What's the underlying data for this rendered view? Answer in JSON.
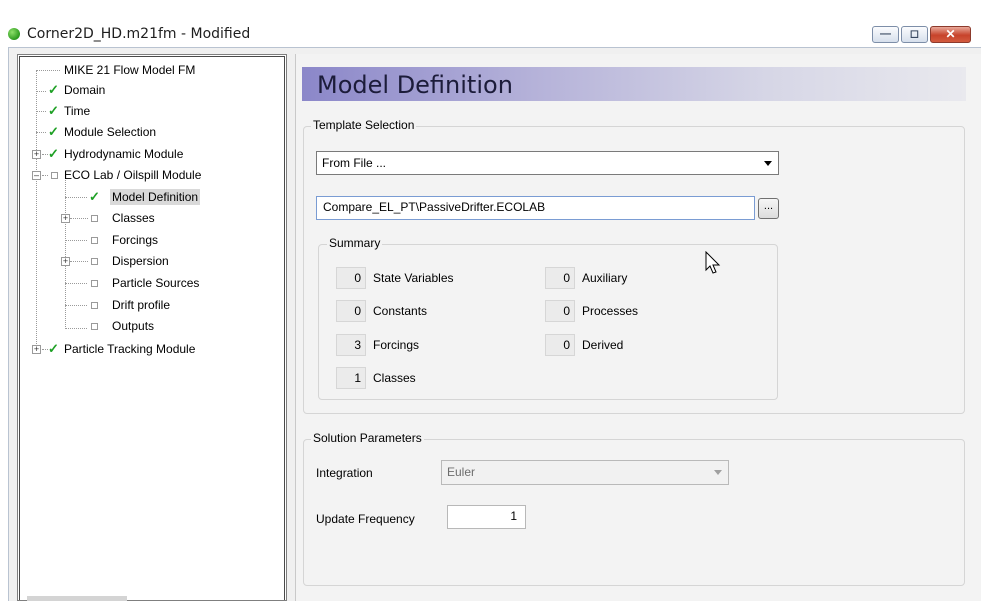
{
  "window": {
    "title": "Corner2D_HD.m21fm - Modified",
    "minimize_icon": "minimize-icon",
    "maximize_icon": "maximize-icon",
    "close_icon": "close-icon"
  },
  "tree": {
    "root": "MIKE 21 Flow Model FM",
    "items": [
      {
        "label": "Domain",
        "state": "checked"
      },
      {
        "label": "Time",
        "state": "checked"
      },
      {
        "label": "Module Selection",
        "state": "checked"
      },
      {
        "label": "Hydrodynamic Module",
        "state": "checked",
        "expander": "+"
      },
      {
        "label": "ECO Lab / Oilspill Module",
        "state": "unchecked",
        "expander": "-"
      },
      {
        "label": "Model Definition",
        "state": "checked",
        "selected": true
      },
      {
        "label": "Classes",
        "state": "unchecked",
        "expander": "+"
      },
      {
        "label": "Forcings",
        "state": "unchecked"
      },
      {
        "label": "Dispersion",
        "state": "unchecked",
        "expander": "+"
      },
      {
        "label": "Particle Sources",
        "state": "unchecked"
      },
      {
        "label": "Drift profile",
        "state": "unchecked"
      },
      {
        "label": "Outputs",
        "state": "unchecked"
      },
      {
        "label": "Particle Tracking Module",
        "state": "checked",
        "expander": "+"
      }
    ]
  },
  "page": {
    "title": "Model Definition"
  },
  "template_selection": {
    "legend": "Template Selection",
    "source_value": "From File ...",
    "file_value": "Compare_EL_PT\\PassiveDrifter.ECOLAB",
    "browse_label": "..."
  },
  "summary": {
    "legend": "Summary",
    "left": [
      {
        "value": "0",
        "label": "State Variables"
      },
      {
        "value": "0",
        "label": "Constants"
      },
      {
        "value": "3",
        "label": "Forcings"
      },
      {
        "value": "1",
        "label": "Classes"
      }
    ],
    "right": [
      {
        "value": "0",
        "label": "Auxiliary"
      },
      {
        "value": "0",
        "label": "Processes"
      },
      {
        "value": "0",
        "label": "Derived"
      }
    ]
  },
  "solution_parameters": {
    "legend": "Solution Parameters",
    "integration_label": "Integration",
    "integration_value": "Euler",
    "update_frequency_label": "Update Frequency",
    "update_frequency_value": "1"
  }
}
